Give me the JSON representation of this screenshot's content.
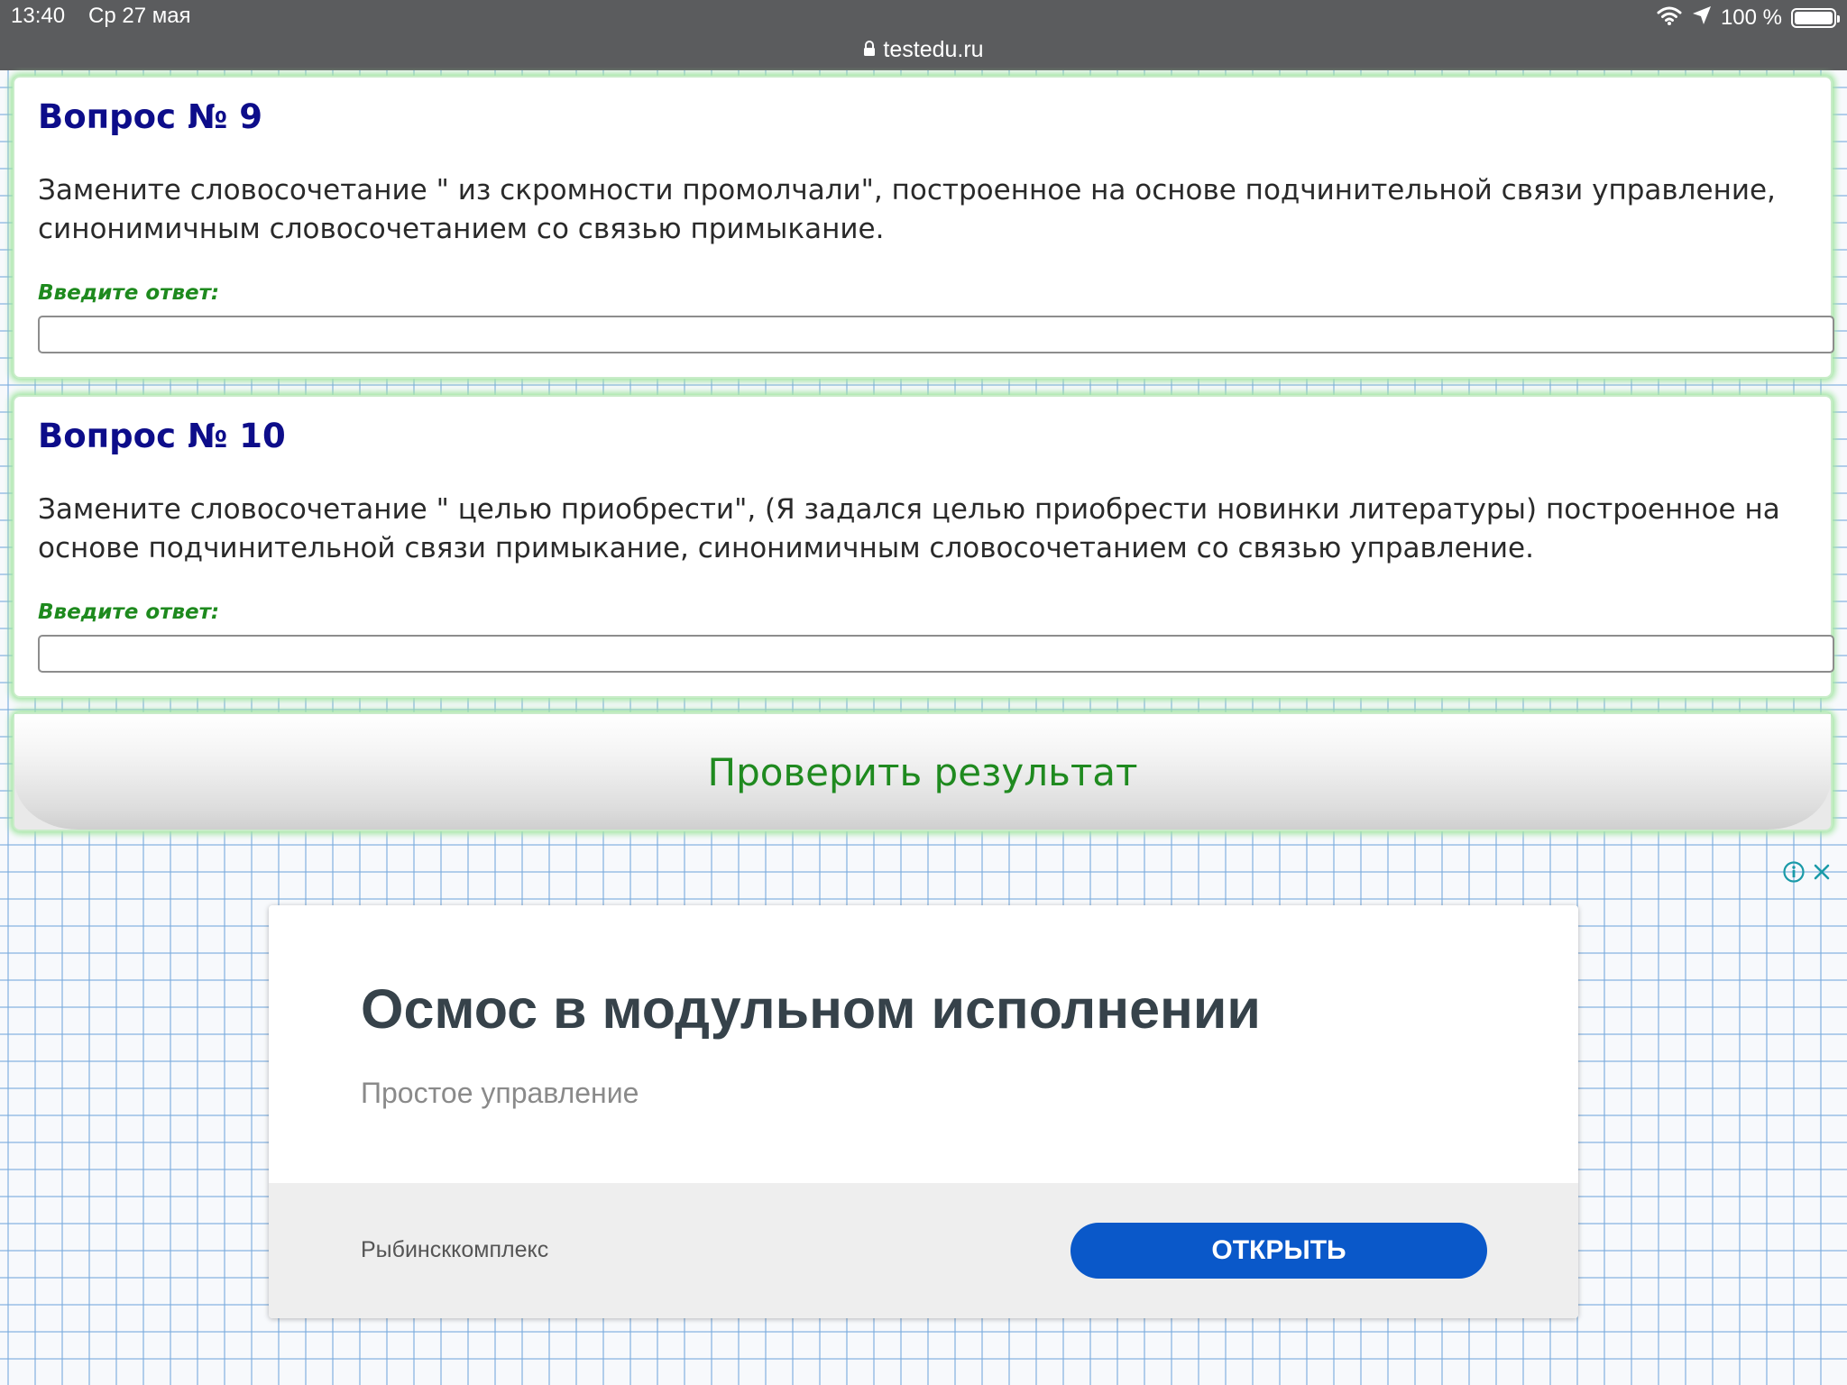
{
  "status_bar": {
    "time": "13:40",
    "date": "Ср 27 мая",
    "battery": "100 %",
    "battery_level": 1.0
  },
  "browser": {
    "url": "testedu.ru"
  },
  "questions": [
    {
      "title": "Вопрос № 9",
      "text": "Замените словосочетание \" из скромности промолчали\", построенное на основе подчинительной связи управление, синонимичным словосочетанием со связью примыкание.",
      "answer_label": "Введите ответ:",
      "answer_value": ""
    },
    {
      "title": "Вопрос № 10",
      "text": "Замените словосочетание \" целью приобрести\", (Я задался целью приобрести новинки литературы) построенное на основе подчинительной связи примыкание, синонимичным словосочетанием со связью управление.",
      "answer_label": "Введите ответ:",
      "answer_value": ""
    }
  ],
  "check_button_label": "Проверить результат",
  "ad": {
    "title": "Осмос в модульном исполнении",
    "subtitle": "Простое управление",
    "advertiser": "Рыбинсккомплекс",
    "open_label": "ОТКРЫТЬ"
  },
  "icons": {
    "wifi": "wifi-icon",
    "location": "location-arrow-icon",
    "battery": "battery-icon",
    "lock": "lock-icon",
    "ad_info": "info-icon",
    "ad_close": "close-icon"
  },
  "colors": {
    "status_bar_bg": "#5b5c5e",
    "question_title": "#0d0d8a",
    "answer_label": "#1e8a1e",
    "check_button_text": "#1f8a1f",
    "card_glow": "#a2e6a2",
    "ad_button_bg": "#0a58c9",
    "ad_title": "#36424a",
    "ad_icons": "#1a9aa8"
  }
}
